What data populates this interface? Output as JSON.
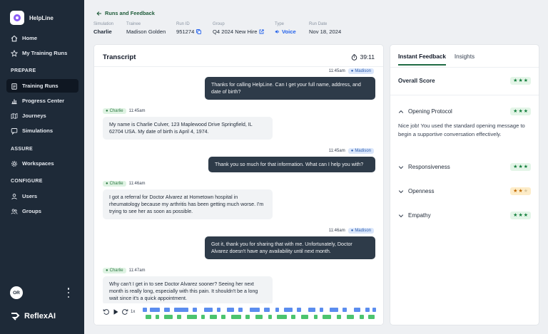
{
  "sidebar": {
    "app_name": "HelpLine",
    "top_items": [
      {
        "label": "Home",
        "icon": "home-icon"
      },
      {
        "label": "My Training Runs",
        "icon": "star-icon"
      }
    ],
    "sections": [
      {
        "title": "PREPARE",
        "items": [
          {
            "label": "Training Runs",
            "icon": "clipboard-icon",
            "active": true
          },
          {
            "label": "Progress Center",
            "icon": "chart-icon"
          },
          {
            "label": "Journeys",
            "icon": "map-icon"
          },
          {
            "label": "Simulations",
            "icon": "chat-icon"
          }
        ]
      },
      {
        "title": "ASSURE",
        "items": [
          {
            "label": "Workspaces",
            "icon": "gear-icon"
          }
        ]
      },
      {
        "title": "CONFIGURE",
        "items": [
          {
            "label": "Users",
            "icon": "user-icon"
          },
          {
            "label": "Groups",
            "icon": "users-icon"
          }
        ]
      }
    ],
    "user_initials": "OR",
    "footer_brand": "ReflexAI"
  },
  "header": {
    "back_label": "Runs and Feedback",
    "fields": [
      {
        "label": "Simulation",
        "value": "Charlie"
      },
      {
        "label": "Trainee",
        "value": "Madison Golden"
      },
      {
        "label": "Run ID",
        "value": "951274"
      },
      {
        "label": "Group",
        "value": "Q4 2024 New Hire"
      },
      {
        "label": "Type",
        "value": "Voice"
      },
      {
        "label": "Run Date",
        "value": "Nov 18, 2024"
      }
    ]
  },
  "transcript": {
    "title": "Transcript",
    "timer": "39:11",
    "messages": [
      {
        "speaker": "Madison",
        "time": "11:45am",
        "text": "Thanks for calling HelpLine. Can I get your full name, address, and date of birth?"
      },
      {
        "speaker": "Charlie",
        "time": "11:45am",
        "text": "My name is Charlie Culver, 123 Maplewood Drive Springfield, IL 62704 USA. My date of birth is April 4, 1974."
      },
      {
        "speaker": "Madison",
        "time": "11:45am",
        "text": "Thank you so much for that information. What can I help you with?"
      },
      {
        "speaker": "Charlie",
        "time": "11:46am",
        "text": "I got a referral for Doctor Alvarez at Hometown hospital in rheumatology because my arthritis has been getting much worse. I'm trying to see her as soon as possible."
      },
      {
        "speaker": "Madison",
        "time": "11:46am",
        "text": "Got it, thank you for sharing that with me. Unfortunately, Doctor Alvarez doesn't have any availability until next month."
      },
      {
        "speaker": "Charlie",
        "time": "11:47am",
        "text": "Why can't I get in to see Doctor Alvarez sooner? Seeing her next month is really long, especially with this pain. It shouldn't be a long wait since it's a quick appointment."
      }
    ],
    "player": {
      "speed": "1x",
      "trainee_color": "#5b8def",
      "sim_color": "#4cc46e"
    }
  },
  "feedback": {
    "tabs": [
      "Instant Feedback",
      "Insights"
    ],
    "overall": {
      "label": "Overall Score",
      "stars": 3
    },
    "categories": [
      {
        "name": "Opening Protocol",
        "stars": 3,
        "expanded": true
      },
      {
        "name": "Responsiveness",
        "stars": 3
      },
      {
        "name": "Openness",
        "stars": 2
      },
      {
        "name": "Empathy",
        "stars": 3
      }
    ],
    "opening_text": "Nice job! You used the standard opening message to begin a supportive conversation effectively."
  }
}
